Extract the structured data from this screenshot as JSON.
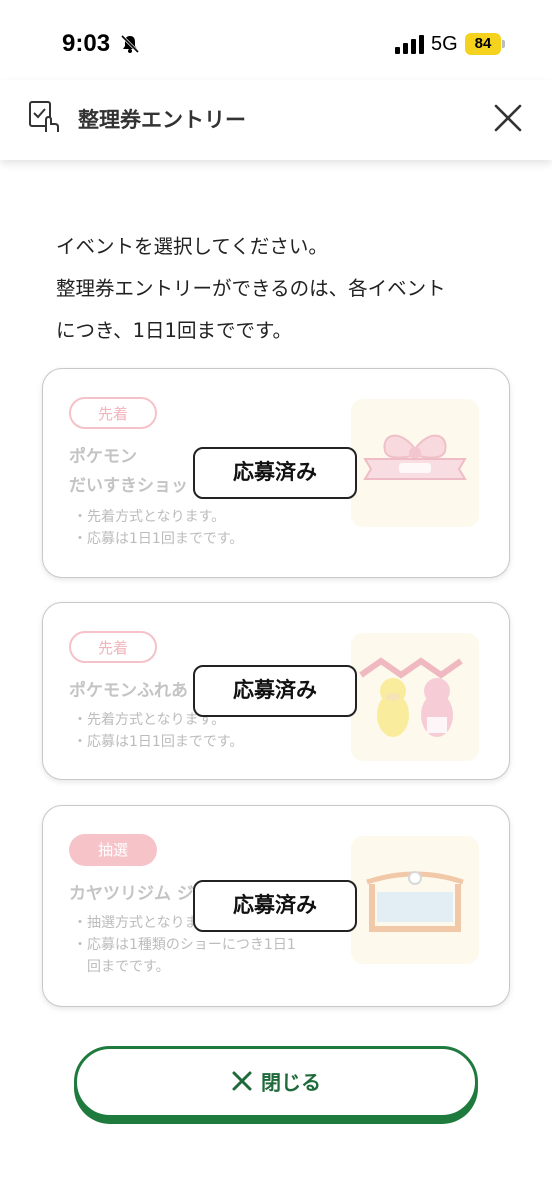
{
  "status": {
    "time": "9:03",
    "network": "5G",
    "battery": "84"
  },
  "header": {
    "title": "整理券エントリー"
  },
  "intro": {
    "lines": [
      "イベントを選択してください。",
      "整理券エントリーができるのは、各イベント",
      "につき、1日1回までです。"
    ]
  },
  "events": [
    {
      "badge": "先着",
      "title_lines": [
        "ポケモン",
        "だいすきショッ"
      ],
      "notes": [
        "・先着方式となります。",
        "・応募は1日1回までです。"
      ],
      "status_label": "応募済み",
      "image_icon": "bow-sign-illustration"
    },
    {
      "badge": "先着",
      "title_lines": [
        "ポケモンふれあ"
      ],
      "notes": [
        "・先着方式となります。",
        "・応募は1日1回までです。"
      ],
      "status_label": "応募済み",
      "image_icon": "psyduck-slowpoke-illustration"
    },
    {
      "badge": "抽選",
      "title_lines": [
        "カヤツリジム ジ"
      ],
      "notes": [
        "・抽選方式となります。",
        "・応募は1種類のショーにつき1日1",
        "　回までです。"
      ],
      "status_label": "応募済み",
      "image_icon": "gym-building-illustration"
    }
  ],
  "footer": {
    "close_label": "閉じる"
  },
  "colors": {
    "accent_green": "#1f7a3d",
    "badge_pink": "#f6c3c9",
    "disabled_text": "#c4c4c4"
  }
}
